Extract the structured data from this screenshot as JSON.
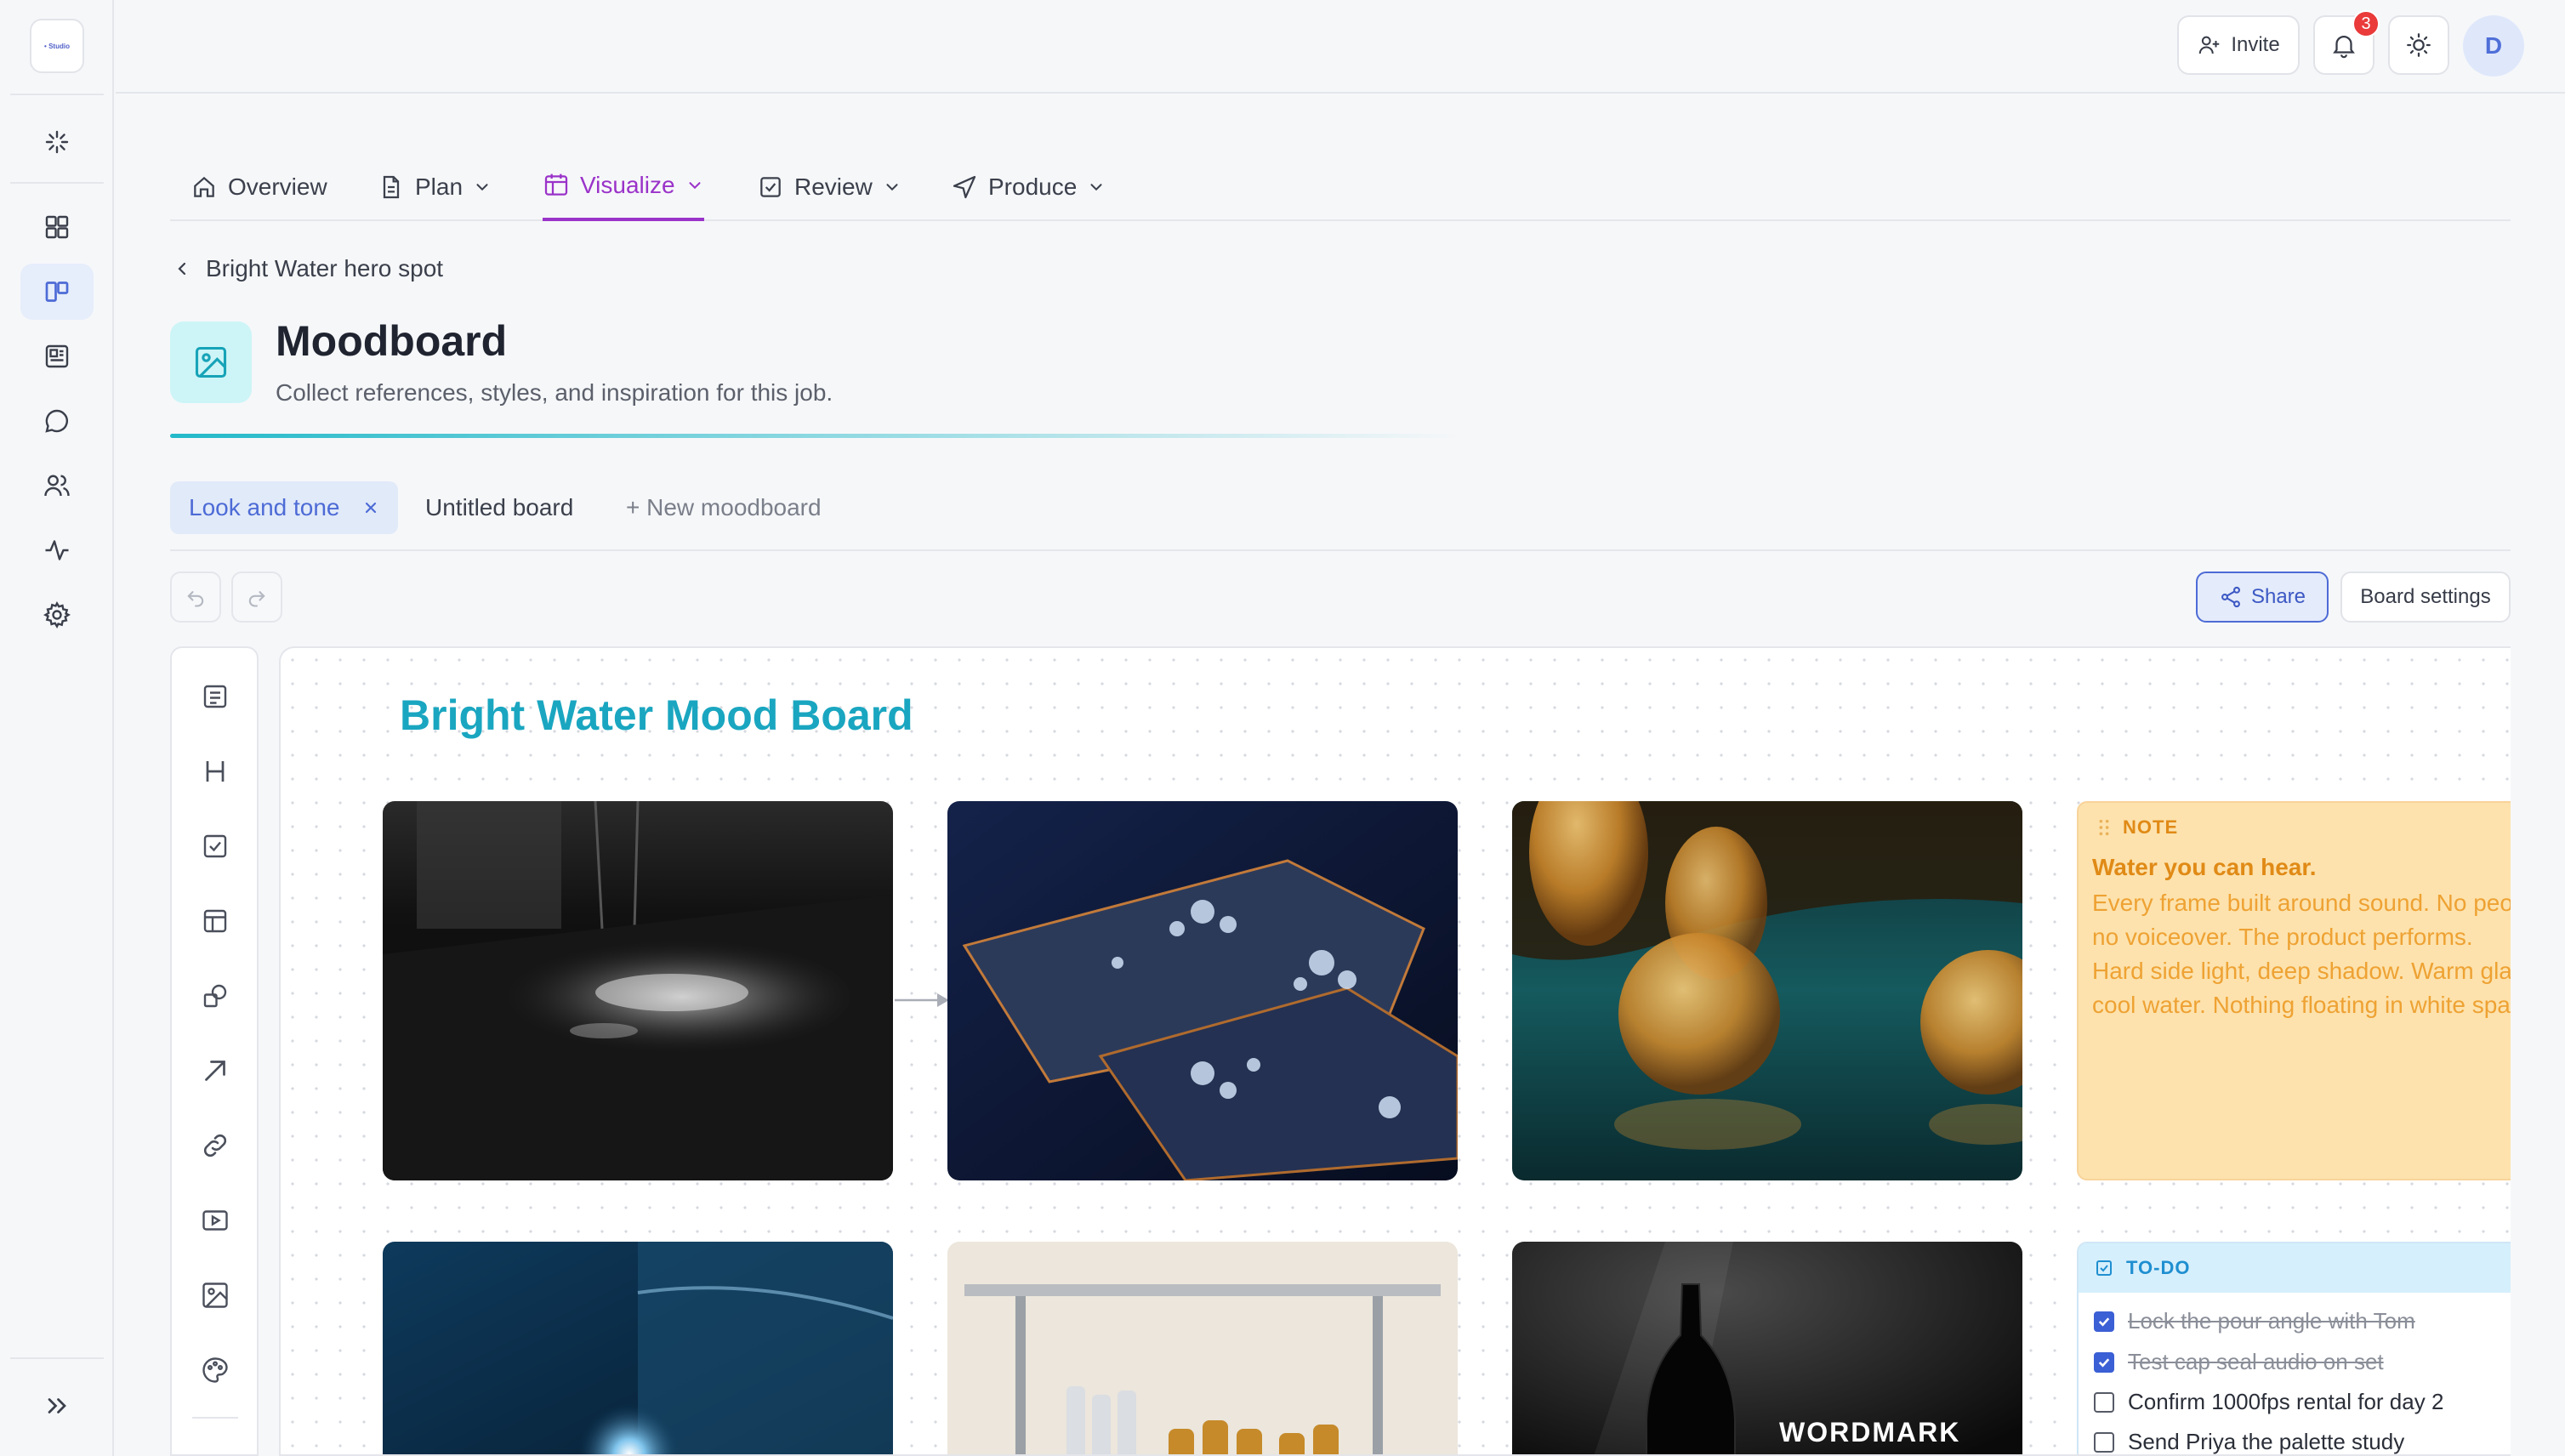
{
  "app": {
    "logo_text": "• Studio"
  },
  "topbar": {
    "invite_label": "Invite",
    "notifications_count": "3",
    "avatar_initial": "D"
  },
  "nav": {
    "tabs": [
      {
        "label": "Overview",
        "icon": "home-icon"
      },
      {
        "label": "Plan",
        "icon": "document-icon"
      },
      {
        "label": "Visualize",
        "icon": "board-icon",
        "active": true
      },
      {
        "label": "Review",
        "icon": "check-square-icon"
      },
      {
        "label": "Produce",
        "icon": "send-icon"
      }
    ]
  },
  "breadcrumb": {
    "label": "Bright Water hero spot"
  },
  "page": {
    "title": "Moodboard",
    "subtitle": "Collect references, styles, and inspiration for this job."
  },
  "boards": {
    "tabs": [
      {
        "label": "Look and tone",
        "active": true
      },
      {
        "label": "Untitled board"
      }
    ],
    "new_label": "+ New moodboard"
  },
  "toolbar": {
    "share_label": "Share",
    "settings_label": "Board settings"
  },
  "canvas": {
    "title": "Bright Water Mood Board",
    "note": {
      "label": "NOTE",
      "heading": "Water you can hear.",
      "lines": [
        "Every frame built around sound. No peo",
        "no voiceover. The product performs.",
        "Hard side light, deep shadow. Warm gla",
        "cool water. Nothing floating in white spa"
      ]
    },
    "todo": {
      "label": "TO-DO",
      "items": [
        {
          "text": "Lock the pour angle with Tom",
          "done": true
        },
        {
          "text": "Test cap seal audio on set",
          "done": true
        },
        {
          "text": "Confirm 1000fps rental for day 2",
          "done": false
        },
        {
          "text": "Send Priya the palette study",
          "done": false
        }
      ]
    },
    "image_text": {
      "wordmark": "WORDMARK"
    }
  },
  "colors": {
    "accent": "#9a33c9",
    "primary": "#4d6bd6",
    "board_title": "#1aa6c0",
    "note_bg": "#fde2ad",
    "todo_accent": "#1f8fd0"
  }
}
